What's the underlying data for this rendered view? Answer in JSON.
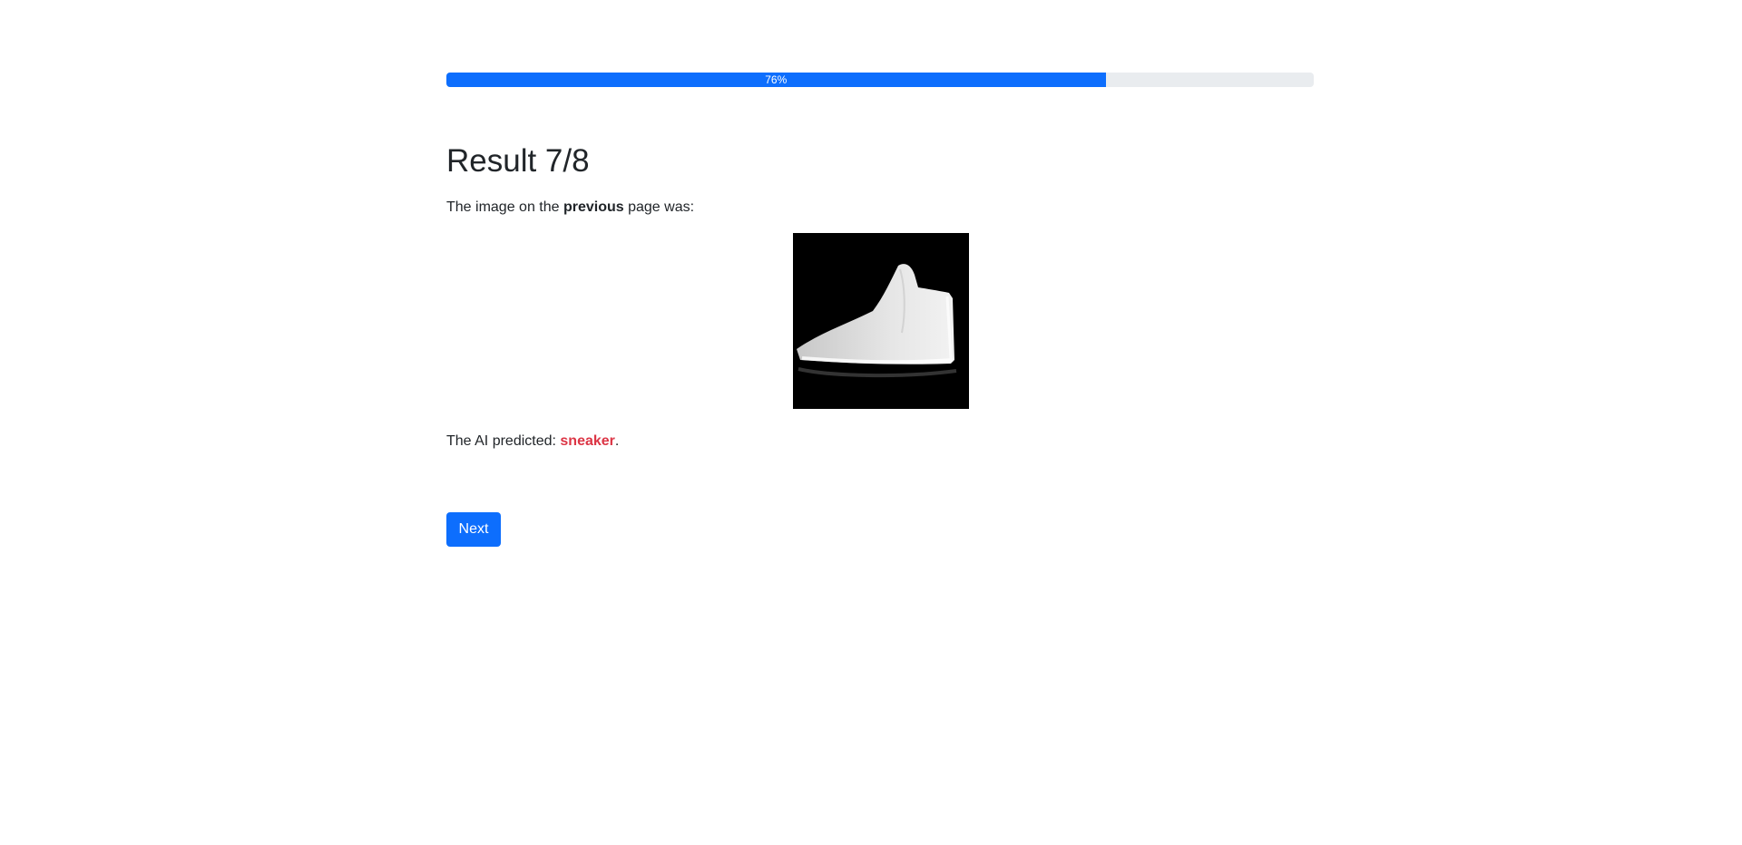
{
  "progress": {
    "value_percent": 76,
    "label": "76%"
  },
  "result": {
    "title": "Result 7/8",
    "intro_before": "The image on the ",
    "intro_bold": "previous",
    "intro_after": " page was:",
    "image_icon": "sneaker-image",
    "predicted_prefix": "The AI predicted: ",
    "predicted_label": "sneaker",
    "predicted_suffix": ".",
    "prediction_color": "#dc3545"
  },
  "next_button": {
    "label": "Next"
  },
  "colors": {
    "accent": "#0d6efd",
    "track": "#e9ecef"
  }
}
